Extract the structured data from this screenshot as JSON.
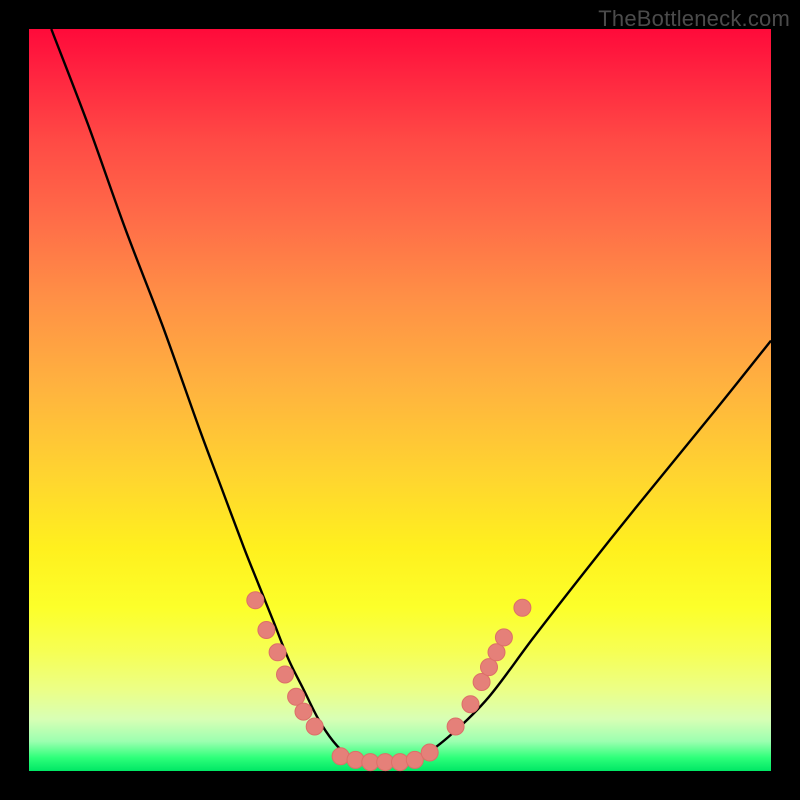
{
  "watermark": "TheBottleneck.com",
  "colors": {
    "frame": "#000000",
    "curve": "#000000",
    "marker_fill": "#e58079",
    "marker_stroke": "#dc6f68"
  },
  "chart_data": {
    "type": "line",
    "title": "",
    "xlabel": "",
    "ylabel": "",
    "xlim": [
      0,
      100
    ],
    "ylim": [
      0,
      100
    ],
    "grid": false,
    "legend": false,
    "series": [
      {
        "name": "bottleneck-curve",
        "x": [
          3,
          8,
          13,
          18,
          23,
          26,
          29,
          31,
          33,
          35,
          37,
          39,
          41,
          43,
          45,
          47,
          50,
          53,
          57,
          62,
          68,
          75,
          83,
          92,
          100
        ],
        "y": [
          100,
          87,
          73,
          60,
          46,
          38,
          30,
          25,
          20,
          15,
          11,
          7,
          4,
          2,
          1,
          1,
          1,
          2,
          5,
          10,
          18,
          27,
          37,
          48,
          58
        ]
      }
    ],
    "markers": [
      {
        "x": 30.5,
        "y": 23
      },
      {
        "x": 32.0,
        "y": 19
      },
      {
        "x": 33.5,
        "y": 16
      },
      {
        "x": 34.5,
        "y": 13
      },
      {
        "x": 36.0,
        "y": 10
      },
      {
        "x": 37.0,
        "y": 8
      },
      {
        "x": 38.5,
        "y": 6
      },
      {
        "x": 42.0,
        "y": 2
      },
      {
        "x": 44.0,
        "y": 1.5
      },
      {
        "x": 46.0,
        "y": 1.2
      },
      {
        "x": 48.0,
        "y": 1.2
      },
      {
        "x": 50.0,
        "y": 1.2
      },
      {
        "x": 52.0,
        "y": 1.5
      },
      {
        "x": 54.0,
        "y": 2.5
      },
      {
        "x": 57.5,
        "y": 6
      },
      {
        "x": 59.5,
        "y": 9
      },
      {
        "x": 61.0,
        "y": 12
      },
      {
        "x": 62.0,
        "y": 14
      },
      {
        "x": 63.0,
        "y": 16
      },
      {
        "x": 64.0,
        "y": 18
      },
      {
        "x": 66.5,
        "y": 22
      }
    ]
  }
}
